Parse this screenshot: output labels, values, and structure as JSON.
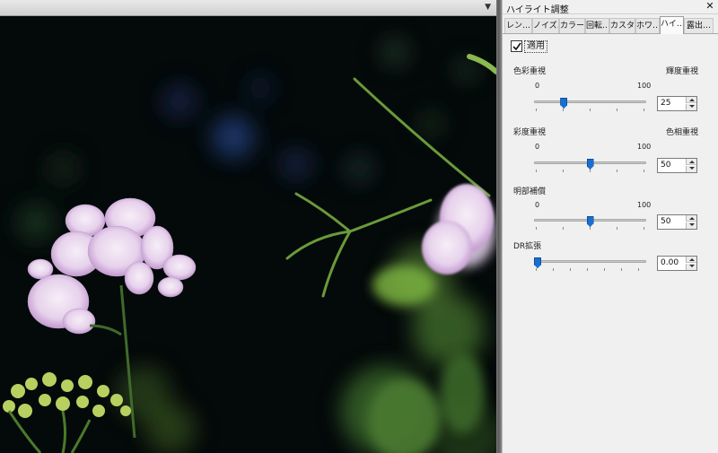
{
  "panel": {
    "title": "ハイライト調整",
    "close_icon": "close-icon"
  },
  "tabs": [
    {
      "label": "レン…",
      "active": false
    },
    {
      "label": "ノイズ…",
      "active": false
    },
    {
      "label": "カラー…",
      "active": false
    },
    {
      "label": "回転…",
      "active": false
    },
    {
      "label": "カスタ…",
      "active": false
    },
    {
      "label": "ホワ…",
      "active": false
    },
    {
      "label": "ハイ…",
      "active": true
    },
    {
      "label": "露出…",
      "active": false
    }
  ],
  "apply": {
    "label": "適用",
    "checked": true
  },
  "sliders": [
    {
      "left_label": "色彩重視",
      "right_label": "輝度重視",
      "min": "0",
      "max": "100",
      "value": "25",
      "level": 0.25
    },
    {
      "left_label": "彩度重視",
      "right_label": "色相重視",
      "min": "0",
      "max": "100",
      "value": "50",
      "level": 0.5
    },
    {
      "left_label": "明部補償",
      "right_label": "",
      "min": "0",
      "max": "100",
      "value": "50",
      "level": 0.5
    },
    {
      "left_label": "DR拡張",
      "right_label": "",
      "min": "",
      "max": "",
      "value": "0.00",
      "level": 0.0
    }
  ],
  "colors": {
    "accent": "#1a6ed0",
    "panel_bg": "#f0f0f0"
  }
}
